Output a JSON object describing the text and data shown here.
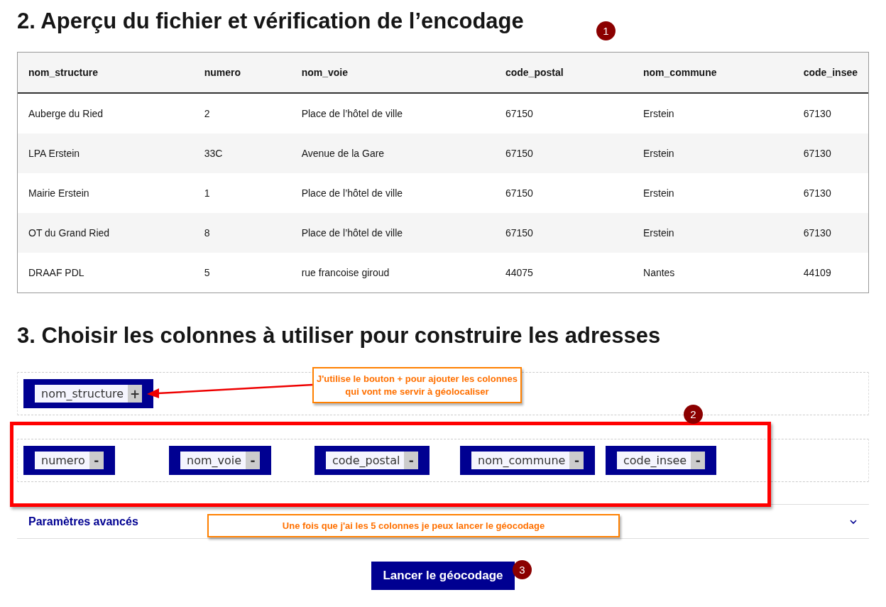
{
  "preview_section": {
    "title": "2. Aperçu du fichier et vérification de l’encodage"
  },
  "table": {
    "columns": [
      "nom_structure",
      "numero",
      "nom_voie",
      "code_postal",
      "nom_commune",
      "code_insee"
    ],
    "rows": [
      [
        "Auberge du Ried",
        "2",
        "Place de l’hôtel de ville",
        "67150",
        "Erstein",
        "67130"
      ],
      [
        "LPA Erstein",
        "33C",
        "Avenue de la Gare",
        "67150",
        "Erstein",
        "67130"
      ],
      [
        "Mairie Erstein",
        "1",
        "Place de l’hôtel de ville",
        "67150",
        "Erstein",
        "67130"
      ],
      [
        "OT du Grand Ried",
        "8",
        "Place de l’hôtel de ville",
        "67150",
        "Erstein",
        "67130"
      ],
      [
        "DRAAF PDL",
        "5",
        "rue francoise giroud",
        "44075",
        "Nantes",
        "44109"
      ]
    ]
  },
  "columns_section": {
    "title": "3. Choisir les colonnes à utiliser pour construire les adresses"
  },
  "available_columns": [
    {
      "name": "nom_structure",
      "action": "+"
    }
  ],
  "selected_columns": [
    {
      "name": "numero",
      "action": "-"
    },
    {
      "name": "nom_voie",
      "action": "-"
    },
    {
      "name": "code_postal",
      "action": "-"
    },
    {
      "name": "nom_commune",
      "action": "-"
    },
    {
      "name": "code_insee",
      "action": "-"
    }
  ],
  "advanced_settings": {
    "label": "Paramètres avancés",
    "expanded": false
  },
  "submit_button": {
    "label": "Lancer le géocodage"
  },
  "annotations": [
    {
      "kind": "badge",
      "text": "1"
    },
    {
      "kind": "callout",
      "text": "J'utilise le bouton + pour ajouter les colonnes qui vont me servir à géolocaliser"
    },
    {
      "kind": "badge",
      "text": "2"
    },
    {
      "kind": "callout",
      "text": "Une fois que j'ai les 5 colonnes je peux lancer le géocodage"
    },
    {
      "kind": "badge",
      "text": "3"
    }
  ]
}
